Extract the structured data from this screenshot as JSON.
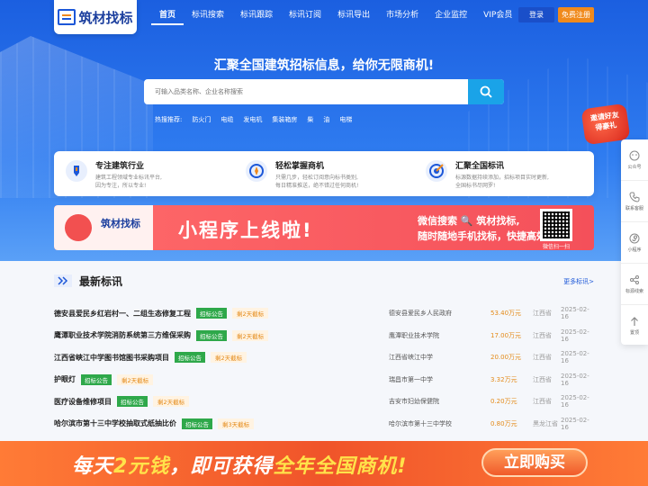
{
  "brand": {
    "logo_text": "筑材找标"
  },
  "nav": [
    "首页",
    "标讯搜索",
    "标讯跟踪",
    "标讯订阅",
    "标讯导出",
    "市场分析",
    "企业监控",
    "VIP会员"
  ],
  "auth": {
    "login": "登录",
    "register": "免费注册"
  },
  "hero": {
    "slogan": "汇聚全国建筑招标信息，给你无限商机!",
    "search_placeholder": "可输入品类名称、企业名称搜索",
    "hot_label": "热搜推荐:",
    "hot": [
      "防火门",
      "电缆",
      "发电机",
      "集装箱房",
      "柴",
      "油",
      "电梯"
    ]
  },
  "promo_badge": {
    "line1": "邀请好友",
    "line2": "得豪礼"
  },
  "features": [
    {
      "icon": "pen-icon",
      "title": "专注建筑行业",
      "desc1": "建筑工程领域专业标讯平台,",
      "desc2": "因为专注，所以专业!"
    },
    {
      "icon": "compass-icon",
      "title": "轻松掌握商机",
      "desc1": "只需几步，轻松订阅意向标书类别,",
      "desc2": "每日精准推送，绝不错过任何商机!"
    },
    {
      "icon": "target-icon",
      "title": "汇聚全国标讯",
      "desc1": "标源数据持续添加，招标项目实时更新,",
      "desc2": "全国标书尽网罗!"
    }
  ],
  "banner": {
    "logo_text": "筑材找标",
    "headline": "小程序上线啦!",
    "line1": "微信搜索 🔍 筑材找标,",
    "line2": "随时随地手机找标，快捷高效~",
    "qr_caption": "微信扫一扫"
  },
  "sidebar": [
    "公众号",
    "联系客服",
    "小程序",
    "标源线索",
    "置顶"
  ],
  "latest": {
    "title": "最新标讯",
    "more": "更多标讯>",
    "rows": [
      {
        "title": "德安县爱民乡红岩村一、二组生态修复工程",
        "tag": "招标公告",
        "deadline": "剩2天截标",
        "org": "德安县爱民乡人民政府",
        "amount": "53.40万元",
        "province": "江西省",
        "date": "2025-02-16"
      },
      {
        "title": "鹰潭职业技术学院消防系统第三方维保采购",
        "tag": "招标公告",
        "deadline": "剩2天截标",
        "org": "鹰潭职业技术学院",
        "amount": "17.00万元",
        "province": "江西省",
        "date": "2025-02-16"
      },
      {
        "title": "江西省峡江中学图书馆图书采购项目",
        "tag": "招标公告",
        "deadline": "剩2天截标",
        "org": "江西省峡江中学",
        "amount": "20.00万元",
        "province": "江西省",
        "date": "2025-02-16"
      },
      {
        "title": "护眼灯",
        "tag": "招标公告",
        "deadline": "剩2天截标",
        "org": "瑞昌市第一中学",
        "amount": "3.32万元",
        "province": "江西省",
        "date": "2025-02-16"
      },
      {
        "title": "医疗设备维修项目",
        "tag": "招标公告",
        "deadline": "剩2天截标",
        "org": "吉安市妇幼保健院",
        "amount": "0.20万元",
        "province": "江西省",
        "date": "2025-02-16"
      },
      {
        "title": "哈尔滨市第十三中学校抽取式纸抽比价",
        "tag": "招标公告",
        "deadline": "剩3天截标",
        "org": "哈尔滨市第十三中学校",
        "amount": "0.80万元",
        "province": "黑龙江省",
        "date": "2025-02-16"
      }
    ]
  },
  "bottom_bar": {
    "text_a": "每天",
    "text_b": "2元钱",
    "text_c": "，即可获得",
    "text_d": "全年全国商机!",
    "button": "立即购买"
  },
  "colors": {
    "primary": "#1c57d8",
    "orange": "#f08a1c",
    "green": "#2ea84a",
    "banner_red": "#f4505a"
  }
}
